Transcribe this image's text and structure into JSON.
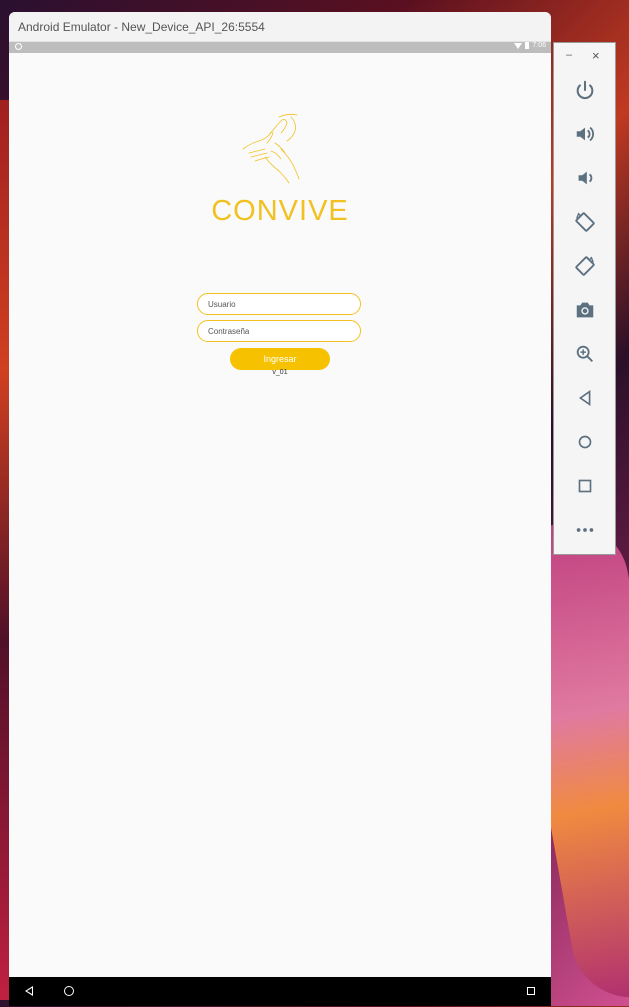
{
  "window": {
    "title": "Android Emulator - New_Device_API_26:5554"
  },
  "status_bar": {
    "time": "7:06"
  },
  "app": {
    "brand_name": "CONVIVE",
    "username_placeholder": "Usuario",
    "password_placeholder": "Contraseña",
    "login_button": "Ingresar",
    "version": "v_01"
  },
  "side_controls": {
    "minimize": "–",
    "close": "×",
    "buttons": [
      "power-icon",
      "volume-up-icon",
      "volume-down-icon",
      "rotate-left-icon",
      "rotate-right-icon",
      "camera-icon",
      "zoom-icon",
      "back-icon",
      "home-icon",
      "overview-icon",
      "more-icon"
    ]
  },
  "colors": {
    "accent": "#f2c121",
    "button": "#f6c200",
    "side_icon": "#5c7080"
  }
}
